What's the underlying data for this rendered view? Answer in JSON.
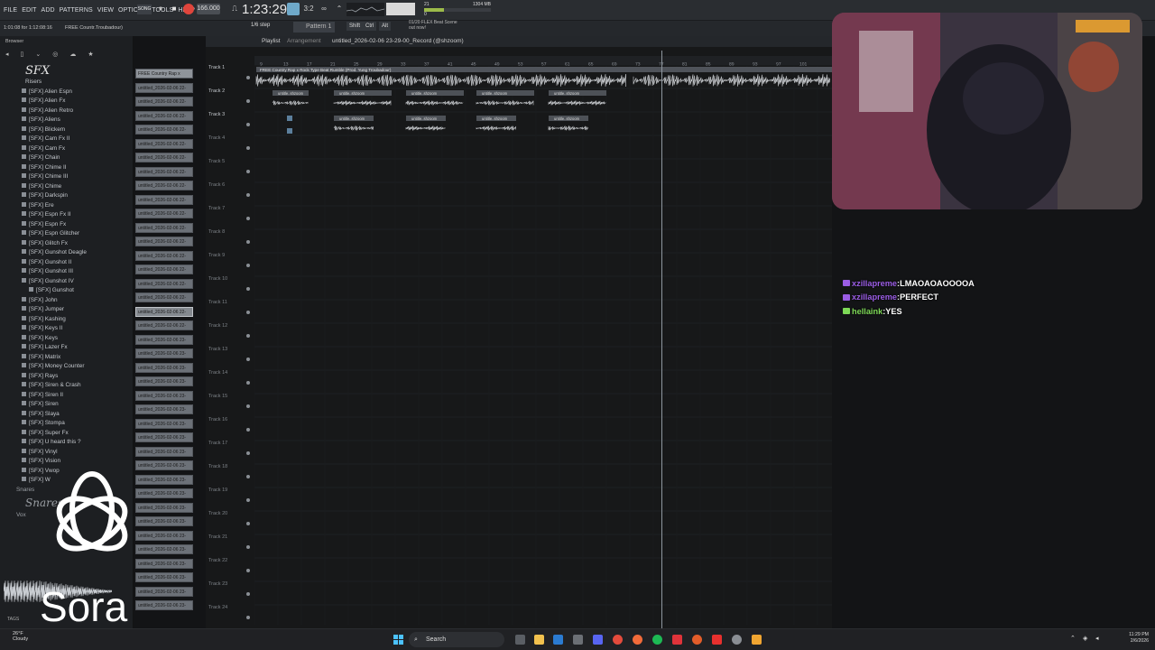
{
  "menubar": {
    "items": [
      "FILE",
      "EDIT",
      "ADD",
      "PATTERNS",
      "VIEW",
      "OPTIONS",
      "TOOLS",
      "HELP"
    ],
    "song_badge": "SONG",
    "tempo": "166.000",
    "song_position": "1:23:29",
    "time_sig": "3:2",
    "cpu_mem": "1304 MB",
    "cpu_voices": "21",
    "cpu_poly": "0"
  },
  "toolbar": {
    "hint_left": "1:01:08 for 1:12:08:16",
    "hint_right": "FREE Countr.Troubadour)",
    "step": "1/6 step",
    "pattern": "Pattern 1",
    "keys": [
      "Shift",
      "Ctrl",
      "Alt"
    ],
    "news_line1": "01/20 FLEX Beat Scene",
    "news_line2": "out now!"
  },
  "browser": {
    "header": "Browser",
    "section_title": "SFX",
    "folder": "Risers",
    "items": [
      "[SFX] Alien Espn",
      "[SFX] Alien Fx",
      "[SFX] Alien Retro",
      "[SFX] Aliens",
      "[SFX] Blickem",
      "[SFX] Cam Fx II",
      "[SFX] Cam Fx",
      "[SFX] Chain",
      "[SFX] Chime II",
      "[SFX] Chime III",
      "[SFX] Chime",
      "[SFX] Darkspin",
      "[SFX] Ere",
      "[SFX] Espn Fx II",
      "[SFX] Espn Fx",
      "[SFX] Espn Glitcher",
      "[SFX] Glitch Fx",
      "[SFX] Gunshot Deagle",
      "[SFX] Gunshot II",
      "[SFX] Gunshot III",
      "[SFX] Gunshot IV",
      "[SFX] Gunshot",
      "[SFX] John",
      "[SFX] Jumper",
      "[SFX] Kashing",
      "[SFX] Keys II",
      "[SFX] Keys",
      "[SFX] Lazer Fx",
      "[SFX] Matrix",
      "[SFX] Money Counter",
      "[SFX] Rays",
      "[SFX] Siren & Crash",
      "[SFX] Siren II",
      "[SFX] Siren",
      "[SFX] Slaya",
      "[SFX] Stompa",
      "[SFX] Super Fx",
      "[SFX] U heard this ?",
      "[SFX] Vinyl",
      "[SFX] Vision",
      "[SFX] Vwop",
      "[SFX] W"
    ],
    "selected_index": 21,
    "subfolders": [
      "Snares",
      "Vox"
    ],
    "snares_title": "Snares",
    "tags_label": "TAGS"
  },
  "channels": {
    "first": "FREE Country Rap x",
    "items": [
      "untitled_2026-02-06 22-",
      "untitled_2026-02-06 22-",
      "untitled_2026-02-06 22-",
      "untitled_2026-02-06 22-",
      "untitled_2026-02-06 22-",
      "untitled_2026-02-06 22-",
      "untitled_2026-02-06 22-",
      "untitled_2026-02-06 22-",
      "untitled_2026-02-06 22-",
      "untitled_2026-02-06 22-",
      "untitled_2026-02-06 22-",
      "untitled_2026-02-06 22-",
      "untitled_2026-02-06 22-",
      "untitled_2026-02-06 22-",
      "untitled_2026-02-06 22-",
      "untitled_2026-02-06 22-",
      "untitled_2026-02-06 22-",
      "untitled_2026-02-06 22-",
      "untitled_2026-02-06 23-",
      "untitled_2026-02-06 23-",
      "untitled_2026-02-06 23-",
      "untitled_2026-02-06 23-",
      "untitled_2026-02-06 23-",
      "untitled_2026-02-06 23-",
      "untitled_2026-02-06 23-",
      "untitled_2026-02-06 23-",
      "untitled_2026-02-06 23-",
      "untitled_2026-02-06 23-",
      "untitled_2026-02-06 23-",
      "untitled_2026-02-06 23-",
      "untitled_2026-02-06 23-",
      "untitled_2026-02-06 23-",
      "untitled_2026-02-06 23-",
      "untitled_2026-02-06 23-",
      "untitled_2026-02-06 23-",
      "untitled_2026-02-06 23-",
      "untitled_2026-02-06 23-",
      "untitled_2026-02-06 23-"
    ],
    "selected_index": 16
  },
  "playlist": {
    "title": "Playlist",
    "subtitle": "Arrangement",
    "record_name": "untitled_2026-02-06 23-29-00_Record (@shzoom)",
    "clip_track1": "FREE Country Rap x Rock Type Beat Rumble (Prod. Yung Troubadour)",
    "clip_label": "untitle..shzoom",
    "tracks": [
      "Track 1",
      "Track 2",
      "Track 3",
      "Track 4",
      "Track 5",
      "Track 6",
      "Track 7",
      "Track 8",
      "Track 9",
      "Track 10",
      "Track 11",
      "Track 12",
      "Track 13",
      "Track 14",
      "Track 15",
      "Track 16",
      "Track 17",
      "Track 18",
      "Track 19",
      "Track 20",
      "Track 21",
      "Track 22",
      "Track 23",
      "Track 24"
    ],
    "ruler_marks": [
      "9",
      "13",
      "17",
      "21",
      "25",
      "29",
      "33",
      "37",
      "41",
      "45",
      "49",
      "53",
      "57",
      "61",
      "65",
      "69",
      "73",
      "77",
      "81",
      "85",
      "89",
      "93",
      "97",
      "101"
    ]
  },
  "chat": {
    "messages": [
      {
        "user": "xzillapreme",
        "text": "LMAOAOAOOOOA",
        "color": "#9b5de5"
      },
      {
        "user": "xzillapreme",
        "text": "PERFECT",
        "color": "#9b5de5"
      },
      {
        "user": "hellaink",
        "text": "YES",
        "color": "#7ed957"
      }
    ]
  },
  "watermark": {
    "text": "Sora"
  },
  "taskbar": {
    "weather_temp": "26°F",
    "weather_desc": "Cloudy",
    "search_label": "Search",
    "time": "11:29 PM",
    "date": "2/6/2026"
  },
  "colors": {
    "accent": "#6fa9c9",
    "record": "#e0453c",
    "chat_purple": "#9b5de5",
    "chat_green": "#7ed957"
  }
}
